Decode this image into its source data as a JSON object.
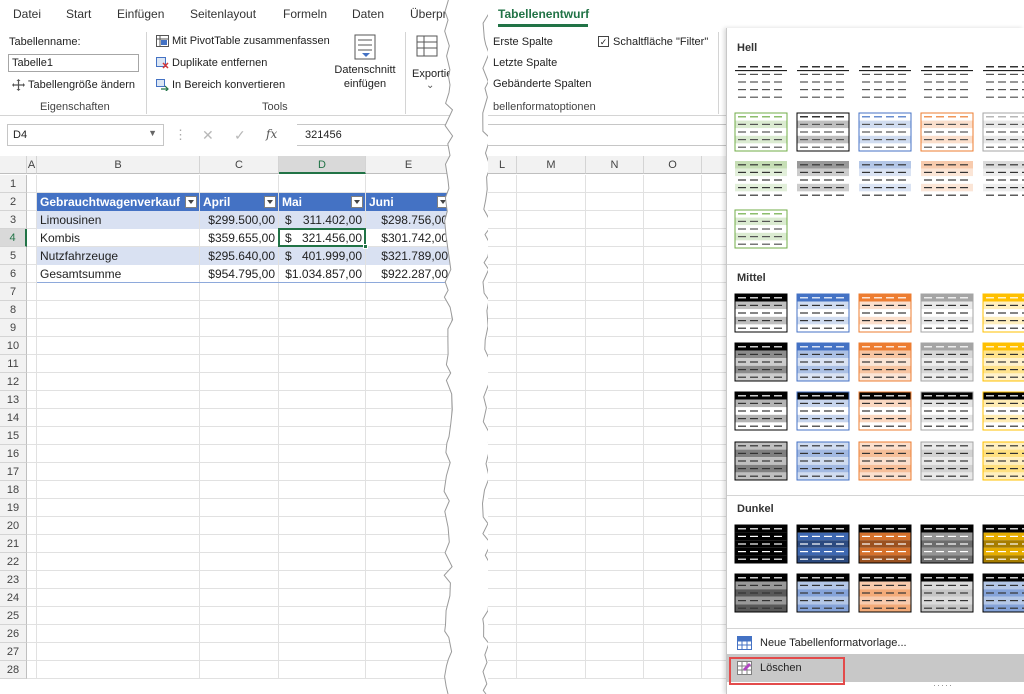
{
  "tabs_left": [
    "Datei",
    "Start",
    "Einfügen",
    "Seitenlayout",
    "Formeln",
    "Daten",
    "Überprü"
  ],
  "tab_right": "Tabellenentwurf",
  "ribbon": {
    "tablename_label": "Tabellenname:",
    "tablename_value": "Tabelle1",
    "resize": "Tabellengröße ändern",
    "group_properties": "Eigenschaften",
    "pivot": "Mit PivotTable zusammenfassen",
    "dupes": "Duplikate entfernen",
    "convert": "In Bereich konvertieren",
    "slicer_line1": "Datenschnitt",
    "slicer_line2": "einfügen",
    "export": "Exportie",
    "group_tools": "Tools",
    "first_col": "Erste Spalte",
    "last_col": "Letzte Spalte",
    "banded_cols": "Gebänderte Spalten",
    "filter_btn": "Schaltfläche \"Filter\"",
    "group_style_options": "bellenformatoptionen"
  },
  "formula_bar": {
    "name_box": "D4",
    "fx": "fx",
    "value": "321456"
  },
  "columns_left": [
    "A",
    "B",
    "C",
    "D",
    "E"
  ],
  "columns_right": [
    "L",
    "M",
    "N",
    "O"
  ],
  "rows": [
    "1",
    "2",
    "3",
    "4",
    "5",
    "6",
    "7",
    "8",
    "9",
    "10",
    "11",
    "12",
    "13",
    "14",
    "15",
    "16",
    "17",
    "18",
    "19",
    "20",
    "21",
    "22",
    "23",
    "24",
    "25",
    "26",
    "27",
    "28"
  ],
  "table": {
    "headers": [
      "Gebrauchtwagenverkauf",
      "April",
      "Mai",
      "Juni"
    ],
    "rows": [
      [
        "Limousinen",
        "$299.500,00",
        "$",
        "311.402,00",
        "$298.756,00"
      ],
      [
        "Kombis",
        "$359.655,00",
        "$",
        "321.456,00",
        "$301.742,00"
      ],
      [
        "Nutzfahrzeuge",
        "$295.640,00",
        "$",
        "401.999,00",
        "$321.789,00"
      ],
      [
        "Gesamtsumme",
        "$954.795,00",
        "",
        "$1.034.857,00",
        "$922.287,00"
      ]
    ]
  },
  "gallery": {
    "section_light": "Hell",
    "section_medium": "Mittel",
    "section_dark": "Dunkel",
    "new_style": "Neue Tabellenformatvorlage...",
    "clear": "Löschen"
  },
  "colors": {
    "accent_green": "#217346",
    "table_header": "#4472c4",
    "table_band": "#d9e1f2",
    "highlight_red": "#e34b4b",
    "swatch_palette": [
      "#000000",
      "#4472c4",
      "#ed7d31",
      "#a5a5a5",
      "#ffc000",
      "#70ad47"
    ]
  }
}
